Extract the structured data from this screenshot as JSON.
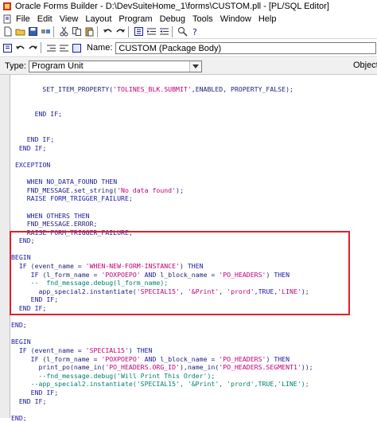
{
  "window": {
    "title": "Oracle Forms Builder - D:\\DevSuiteHome_1\\forms\\CUSTOM.pll - [PL/SQL Editor]"
  },
  "menu": [
    "File",
    "Edit",
    "View",
    "Layout",
    "Program",
    "Debug",
    "Tools",
    "Window",
    "Help"
  ],
  "toolbar": {
    "name_label": "Name:",
    "name_value": "CUSTOM (Package Body)"
  },
  "typebar": {
    "type_label": "Type:",
    "type_value": "Program Unit",
    "object_label": "Object:"
  },
  "icons": {
    "app": "oracle-forms-icon",
    "toolbar": [
      "new-icon",
      "open-icon",
      "save-icon",
      "connect-icon",
      "cut-icon",
      "copy-icon",
      "paste-icon",
      "undo-icon",
      "redo-icon",
      "compile-icon",
      "indent-icon",
      "outdent-icon",
      "find-icon",
      "help-icon"
    ]
  },
  "colors": {
    "highlight_border": "#e0202a",
    "keyword": "#1a1aa0",
    "string": "#c0007a",
    "comment": "#00806e"
  },
  "code_lines": [
    "",
    "        SET_ITEM_PROPERTY('TOLINES_BLK.SUBMIT',ENABLED, PROPERTY_FALSE);",
    "",
    "",
    "      END IF;",
    "",
    "",
    "    END IF;",
    "  END IF;",
    "",
    " EXCEPTION",
    "",
    "    WHEN NO_DATA_FOUND THEN",
    "    FND_MESSAGE.set_string('No data found');",
    "    RAISE FORM_TRIGGER_FAILURE;",
    "",
    "    WHEN OTHERS THEN",
    "    FND_MESSAGE.ERROR;",
    "    RAISE FORM_TRIGGER_FAILURE;",
    "  END;",
    "",
    "BEGIN",
    "  IF (event_name = 'WHEN-NEW-FORM-INSTANCE') THEN",
    "     IF (l_form_name = 'POXPOEPO' AND l_block_name = 'PO_HEADERS') THEN",
    "     --  fnd_message.debug(l_form_name);",
    "       app_special2.instantiate('SPECIAL15', '&Print', 'prord',TRUE,'LINE');",
    "     END IF;",
    "  END IF;",
    "",
    "END;",
    "",
    "BEGIN",
    "  IF (event_name = 'SPECIAL15') THEN",
    "     IF (l_form_name = 'POXPOEPO' AND l_block_name = 'PO_HEADERS') THEN",
    "       print_po(name_in('PO_HEADERS.ORG_ID'),name_in('PO_HEADERS.SEGMENT1'));",
    "       --fnd_message.debug('Will Print This Order');",
    "     --app_special2.instantiate('SPECIAL15', '&Print', 'prord',TRUE,'LINE');",
    "     END IF;",
    "  END IF;",
    "",
    "END;"
  ]
}
